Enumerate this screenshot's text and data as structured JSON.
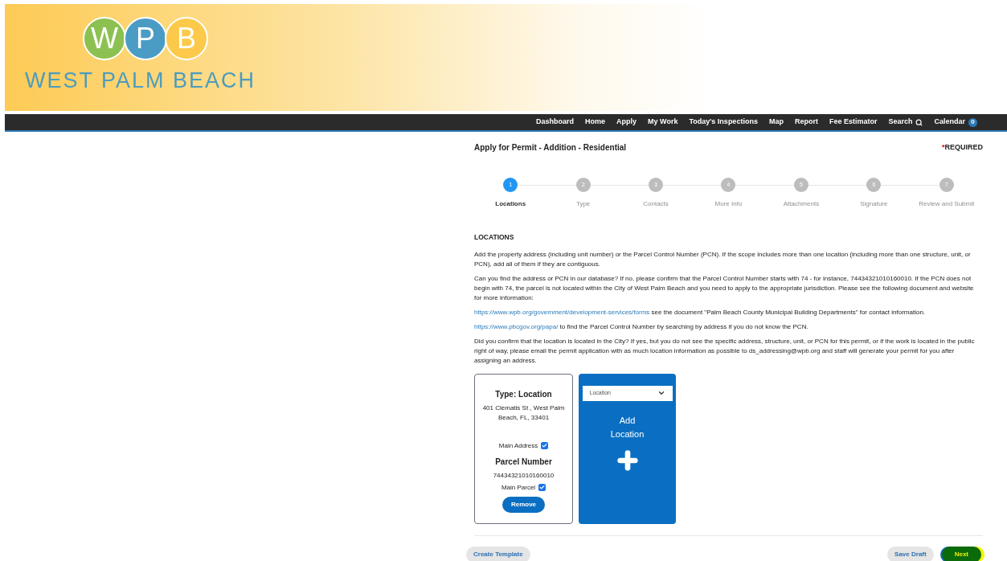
{
  "logo": {
    "letters": [
      "W",
      "P",
      "B"
    ],
    "name": "WEST PALM BEACH"
  },
  "nav": {
    "items": [
      {
        "label": "Dashboard",
        "kind": "link"
      },
      {
        "label": "Home",
        "kind": "link"
      },
      {
        "label": "Apply",
        "kind": "link"
      },
      {
        "label": "My Work",
        "kind": "link"
      },
      {
        "label": "Today's Inspections",
        "kind": "link"
      },
      {
        "label": "Map",
        "kind": "link"
      },
      {
        "label": "Report",
        "kind": "link"
      },
      {
        "label": "Fee Estimator",
        "kind": "link"
      },
      {
        "label": "Search",
        "kind": "search"
      },
      {
        "label": "Calendar",
        "kind": "calendar",
        "badge": "0"
      }
    ]
  },
  "page": {
    "title": "Apply for Permit - Addition - Residential",
    "required_mark": "*",
    "required": "REQUIRED"
  },
  "steps": [
    {
      "number": "1",
      "label": "Locations",
      "selected": true
    },
    {
      "number": "2",
      "label": "Type",
      "selected": false
    },
    {
      "number": "3",
      "label": "Contacts",
      "selected": false
    },
    {
      "number": "4",
      "label": "More Info",
      "selected": false
    },
    {
      "number": "5",
      "label": "Attachments",
      "selected": false
    },
    {
      "number": "6",
      "label": "Signature",
      "selected": false
    },
    {
      "number": "7",
      "label": "Review and Submit",
      "selected": false
    }
  ],
  "section": {
    "heading": "LOCATIONS",
    "paragraphs": [
      {
        "text": "Add the property address (including unit number) or the Parcel Control Number (PCN).  If the scope includes more than one location (including more than one structure, unit, or PCN), add all of them if they are contiguous."
      },
      {
        "text": "Can you find the address or PCN in our database? If no, please confirm that the Parcel Control Number starts with 74 - for instance, 74434321010160010.  If the PCN does not begin with 74, the parcel is not located within the City of West Palm Beach and you need to apply to the appropriate jurisdiction.  Please see the following document and website for more information:"
      },
      {
        "link": "https://www.wpb.org/government/development-services/forms",
        "text": "see the document \"Palm Beach County Municipal Building Departments\" for contact information."
      },
      {
        "link": "https://www.pbcgov.org/papa/",
        "text": "to find the Parcel Control Number by searching by address if you do not know the PCN."
      },
      {
        "text": "Did you confirm that the location is located in the City?  If yes, but you do not see the specific address, structure, unit, or PCN for this permit, or if the work is located in the public right of way, please email the permit application with as much location information as possible to ds_addressing@wpb.org and staff will generate your permit for you after assigning an address."
      }
    ]
  },
  "location_card": {
    "title": "Type: Location",
    "address": "401 Clematis St , West Palm Beach, FL, 33401",
    "main_address": {
      "label": "Main Address",
      "checked": true
    },
    "parcel_heading": "Parcel Number",
    "parcel": "74434321010160010",
    "main_parcel": {
      "label": "Main Parcel",
      "checked": true
    },
    "remove": "Remove"
  },
  "add_card": {
    "select": "Location",
    "label": "Add Location"
  },
  "footer": {
    "create_template": "Create Template",
    "save_draft": "Save Draft",
    "next": "Next"
  }
}
